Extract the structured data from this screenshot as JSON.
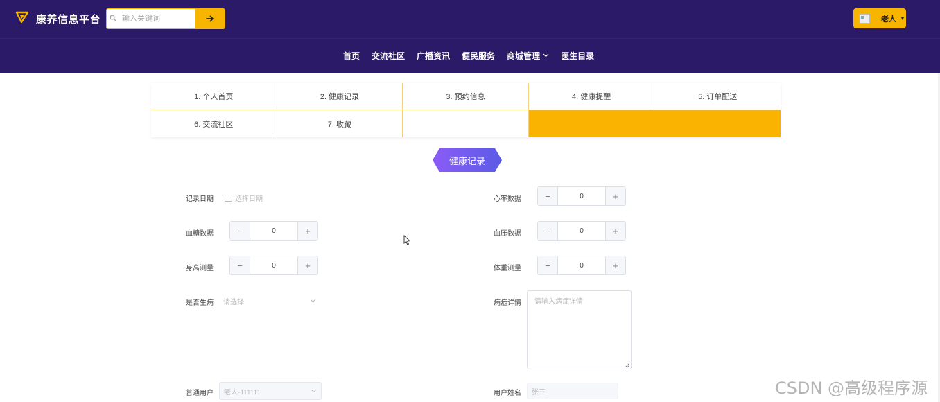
{
  "app": {
    "title": "康养信息平台"
  },
  "search": {
    "placeholder": "输入关键词",
    "button_icon": "arrow-right-icon"
  },
  "user_menu": {
    "name": "老人"
  },
  "nav": {
    "items": [
      {
        "label": "首页"
      },
      {
        "label": "交流社区"
      },
      {
        "label": "广播资讯"
      },
      {
        "label": "便民服务"
      },
      {
        "label": "商城管理",
        "has_dropdown": true
      },
      {
        "label": "医生目录"
      }
    ]
  },
  "tabs": [
    {
      "label": "1. 个人首页"
    },
    {
      "label": "2. 健康记录"
    },
    {
      "label": "3. 预约信息"
    },
    {
      "label": "4. 健康提醒"
    },
    {
      "label": "5. 订单配送"
    },
    {
      "label": "6. 交流社区"
    },
    {
      "label": "7. 收藏"
    }
  ],
  "section": {
    "title": "健康记录"
  },
  "form": {
    "record_date": {
      "label": "记录日期",
      "placeholder": "选择日期"
    },
    "heart_rate": {
      "label": "心率数据",
      "value": "0"
    },
    "blood_sugar": {
      "label": "血糖数据",
      "value": "0"
    },
    "blood_pressure": {
      "label": "血压数据",
      "value": "0"
    },
    "height": {
      "label": "身高测量",
      "value": "0"
    },
    "weight": {
      "label": "体重测量",
      "value": "0"
    },
    "is_sick": {
      "label": "是否生病",
      "placeholder": "请选择"
    },
    "symptom": {
      "label": "病症详情",
      "placeholder": "请输入病症详情"
    },
    "ordinary_user": {
      "label": "普通用户",
      "value": "老人-111111"
    },
    "user_name": {
      "label": "用户姓名",
      "value": "张三"
    }
  },
  "watermark": "CSDN @高级程序源",
  "colors": {
    "header_bg": "#2a1a68",
    "accent": "#f7b500",
    "badge_from": "#8b5cf6",
    "badge_to": "#5b5be6"
  }
}
